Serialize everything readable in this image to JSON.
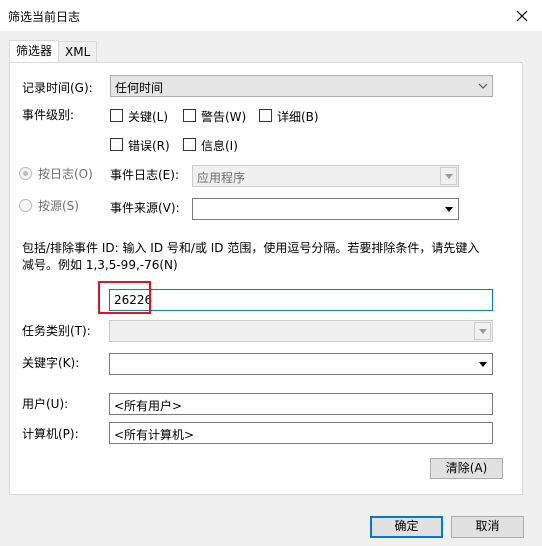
{
  "window": {
    "title": "筛选当前日志"
  },
  "tabs": [
    {
      "label": "筛选器"
    },
    {
      "label": "XML"
    }
  ],
  "filter": {
    "logged_label": "记录时间(G):",
    "logged_value": "任何时间",
    "event_level_label": "事件级别:",
    "levels": [
      {
        "label": "关键(L)",
        "checked": false
      },
      {
        "label": "警告(W)",
        "checked": false
      },
      {
        "label": "详细(B)",
        "checked": false
      },
      {
        "label": "错误(R)",
        "checked": false
      },
      {
        "label": "信息(I)",
        "checked": false
      }
    ],
    "by_log_label": "按日志(O)",
    "by_source_label": "按源(S)",
    "event_logs_label": "事件日志(E):",
    "event_logs_value": "应用程序",
    "event_sources_label": "事件来源(V):",
    "event_sources_value": "",
    "event_id_help_line1": "包括/排除事件 ID: 输入 ID 号和/或 ID 范围，使用逗号分隔。若要排除条件，请先键入",
    "event_id_help_line2": "减号。例如 1,3,5-99,-76(N)",
    "event_id_value": "26226",
    "task_category_label": "任务类别(T):",
    "task_category_value": "",
    "keywords_label": "关键字(K):",
    "keywords_value": "",
    "user_label": "用户(U):",
    "user_value": "<所有用户>",
    "computer_label": "计算机(P):",
    "computer_value": "<所有计算机>",
    "clear_label": "清除(A)"
  },
  "footer": {
    "ok_label": "确定",
    "cancel_label": "取消"
  },
  "colors": {
    "highlight_box": "#e3141e",
    "focus_blue": "#0078d7"
  }
}
